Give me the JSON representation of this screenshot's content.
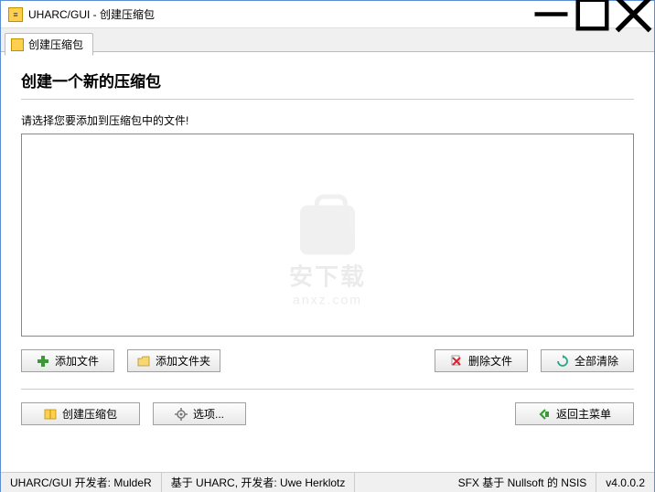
{
  "window": {
    "title": "UHARC/GUI - 创建压缩包"
  },
  "tab": {
    "label": "创建压缩包"
  },
  "heading": "创建一个新的压缩包",
  "prompt": "请选择您要添加到压缩包中的文件!",
  "buttons": {
    "add_file": "添加文件",
    "add_folder": "添加文件夹",
    "delete_file": "删除文件",
    "clear_all": "全部清除",
    "create_archive": "创建压缩包",
    "options": "选项...",
    "back_main": "返回主菜单"
  },
  "status": {
    "dev1": "UHARC/GUI 开发者: MuldeR",
    "dev2": "基于 UHARC, 开发者: Uwe Herklotz",
    "dev3": "SFX 基于 Nullsoft 的 NSIS",
    "version": "v4.0.0.2"
  },
  "watermark": {
    "line1": "安下载",
    "line2": "anxz.com"
  }
}
